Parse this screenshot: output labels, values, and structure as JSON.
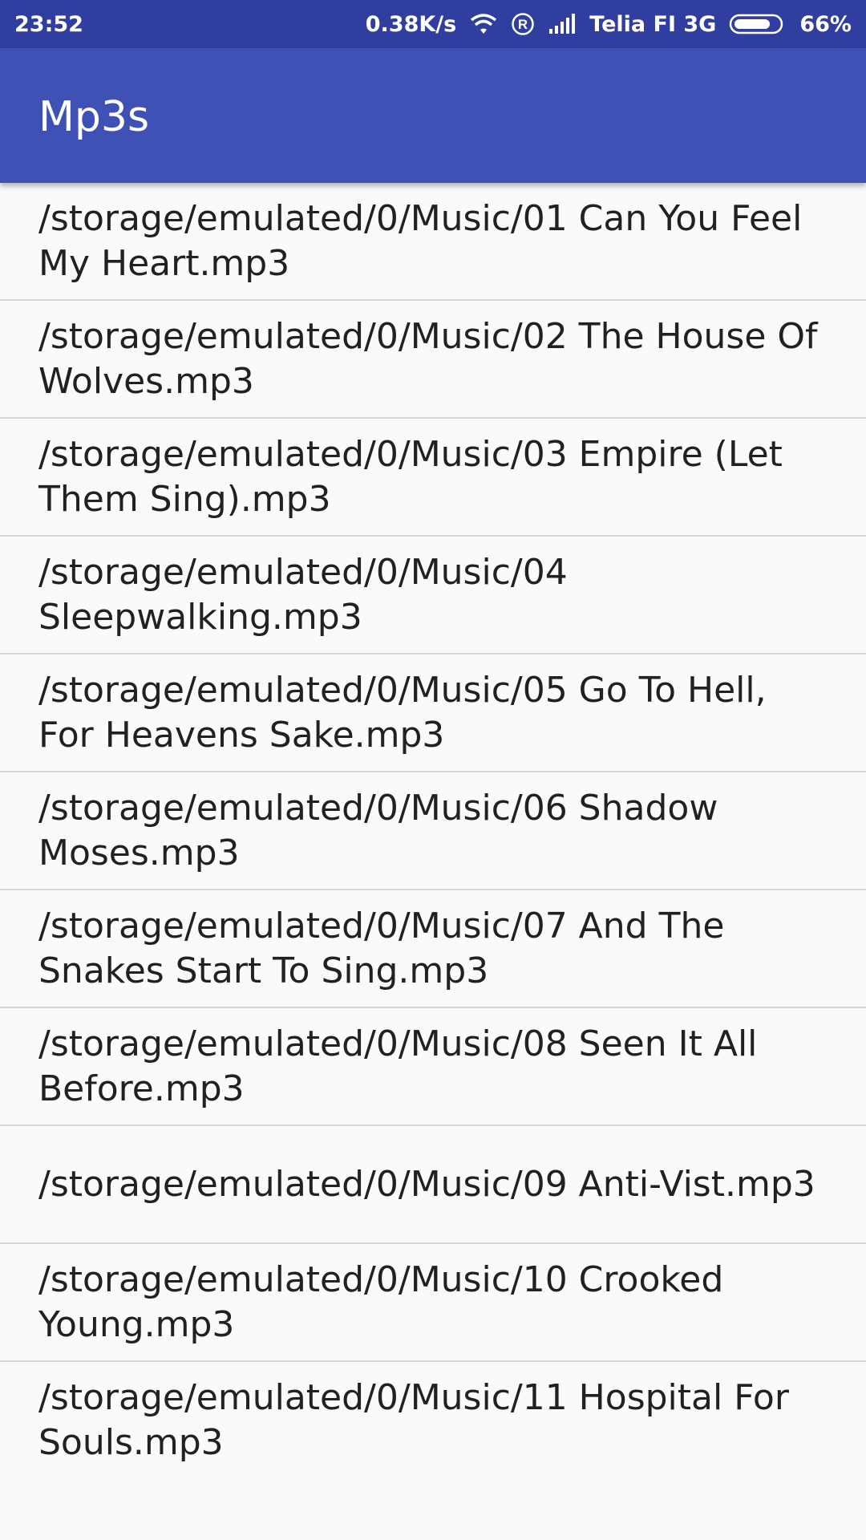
{
  "status_bar": {
    "time": "23:52",
    "speed": "0.38K/s",
    "carrier": "Telia FI 3G",
    "battery": "66%",
    "icons": [
      "wifi-icon",
      "roaming-icon",
      "signal-icon",
      "battery-icon"
    ]
  },
  "app_bar": {
    "title": "Mp3s",
    "color": "#3f51b5",
    "status_color": "#303f9f"
  },
  "files": [
    "/storage/emulated/0/Music/01 Can You Feel My Heart.mp3",
    "/storage/emulated/0/Music/02 The House Of Wolves.mp3",
    "/storage/emulated/0/Music/03 Empire (Let Them Sing).mp3",
    "/storage/emulated/0/Music/04 Sleepwalking.mp3",
    "/storage/emulated/0/Music/05 Go To Hell, For Heavens Sake.mp3",
    "/storage/emulated/0/Music/06 Shadow Moses.mp3",
    "/storage/emulated/0/Music/07 And The Snakes Start To Sing.mp3",
    "/storage/emulated/0/Music/08 Seen It All Before.mp3",
    "/storage/emulated/0/Music/09 Anti-Vist.mp3",
    "/storage/emulated/0/Music/10 Crooked Young.mp3",
    "/storage/emulated/0/Music/11 Hospital For Souls.mp3"
  ]
}
